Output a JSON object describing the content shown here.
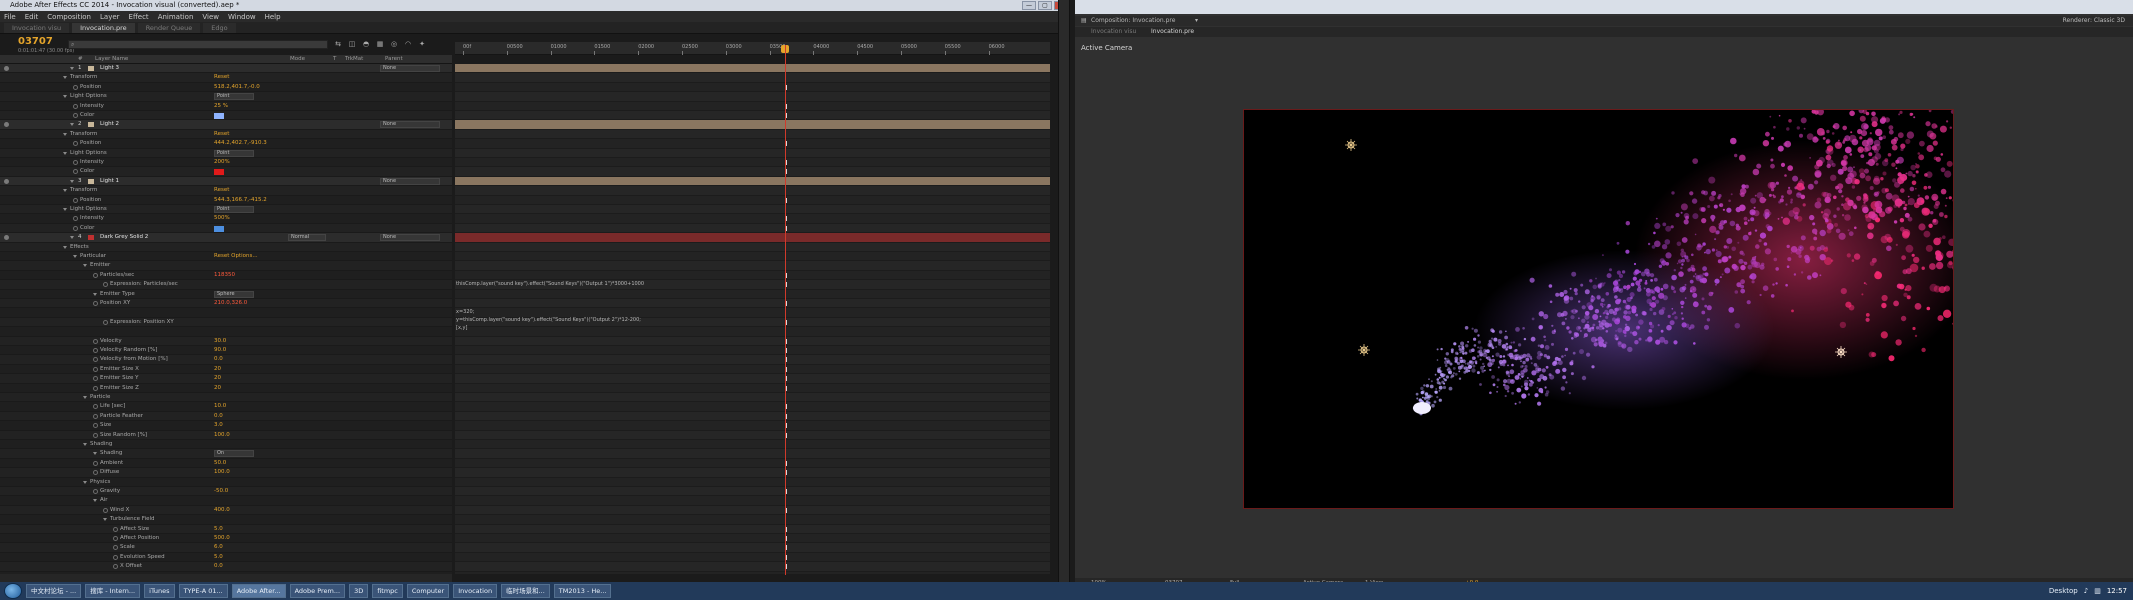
{
  "window": {
    "title": "Adobe After Effects CC 2014 - Invocation visual (converted).aep *",
    "controls": [
      "—",
      "▢",
      "✕"
    ]
  },
  "menu": [
    "File",
    "Edit",
    "Composition",
    "Layer",
    "Effect",
    "Animation",
    "View",
    "Window",
    "Help"
  ],
  "tabs": [
    {
      "label": "Invocation visu",
      "active": false
    },
    {
      "label": "Invocation.pre",
      "active": true
    },
    {
      "label": "Render Queue",
      "active": false
    },
    {
      "label": "Edgo",
      "active": false
    }
  ],
  "timeline": {
    "timecode": "03707",
    "timecode_sub": "0:01:01:47 (30.00 fps)",
    "search": "",
    "ruler_ticks": [
      "00f",
      "00500",
      "01000",
      "01500",
      "02000",
      "02500",
      "03000",
      "03500",
      "04000",
      "04500",
      "05000",
      "05500",
      "06000"
    ],
    "columns": {
      "name": "Layer Name",
      "mode": "Mode",
      "t": "T",
      "trkmat": "TrkMat",
      "parent": "Parent"
    },
    "rows": [
      {
        "kind": "layer",
        "num": "1",
        "name": "Light 3",
        "lc": "#c8b79a",
        "parent": "None"
      },
      {
        "kind": "group",
        "indent": 1,
        "name": "Transform",
        "val": "Reset"
      },
      {
        "kind": "prop",
        "indent": 2,
        "name": "Position",
        "val": "518.2,401.7,-0.0"
      },
      {
        "kind": "group",
        "indent": 1,
        "name": "Light Options",
        "dd": "Point"
      },
      {
        "kind": "prop",
        "indent": 2,
        "name": "Intensity",
        "val": "25 %"
      },
      {
        "kind": "color",
        "indent": 2,
        "name": "Color",
        "color": "#8fb4ff"
      },
      {
        "kind": "layer",
        "num": "2",
        "name": "Light 2",
        "lc": "#c8b79a",
        "parent": "None"
      },
      {
        "kind": "group",
        "indent": 1,
        "name": "Transform",
        "val": "Reset"
      },
      {
        "kind": "prop",
        "indent": 2,
        "name": "Position",
        "val": "444.2,402.7,-910.3"
      },
      {
        "kind": "group",
        "indent": 1,
        "name": "Light Options",
        "dd": "Point"
      },
      {
        "kind": "prop",
        "indent": 2,
        "name": "Intensity",
        "val": "200%"
      },
      {
        "kind": "color",
        "indent": 2,
        "name": "Color",
        "color": "#e01a1a"
      },
      {
        "kind": "layer",
        "num": "3",
        "name": "Light 1",
        "lc": "#c8b79a",
        "parent": "None"
      },
      {
        "kind": "group",
        "indent": 1,
        "name": "Transform",
        "val": "Reset"
      },
      {
        "kind": "prop",
        "indent": 2,
        "name": "Position",
        "val": "544.3,166.7,-415.2"
      },
      {
        "kind": "group",
        "indent": 1,
        "name": "Light Options",
        "dd": "Point"
      },
      {
        "kind": "prop",
        "indent": 2,
        "name": "Intensity",
        "val": "500%"
      },
      {
        "kind": "color",
        "indent": 2,
        "name": "Color",
        "color": "#4d8fe0"
      },
      {
        "kind": "layer",
        "num": "4",
        "name": "Dark Grey Solid 2",
        "lc": "#c03030",
        "parent": "None",
        "mode": "Normal",
        "red": true
      },
      {
        "kind": "group",
        "indent": 1,
        "name": "Effects"
      },
      {
        "kind": "group",
        "indent": 2,
        "name": "Particular",
        "val": "Reset    Options..."
      },
      {
        "kind": "group",
        "indent": 3,
        "name": "Emitter"
      },
      {
        "kind": "prop",
        "indent": 4,
        "name": "Particles/sec",
        "val": "118350",
        "red": true
      },
      {
        "kind": "prop",
        "indent": 5,
        "name": "Expression: Particles/sec",
        "val": ""
      },
      {
        "kind": "group",
        "indent": 4,
        "name": "Emitter Type",
        "dd": "Sphere"
      },
      {
        "kind": "prop",
        "indent": 4,
        "name": "Position XY",
        "val": "210.0,326.0",
        "red": true
      },
      {
        "kind": "spacer"
      },
      {
        "kind": "prop",
        "indent": 5,
        "name": "Expression: Position XY",
        "val": ""
      },
      {
        "kind": "spacer"
      },
      {
        "kind": "prop",
        "indent": 4,
        "name": "Velocity",
        "val": "30.0"
      },
      {
        "kind": "prop",
        "indent": 4,
        "name": "Velocity Random [%]",
        "val": "90.0"
      },
      {
        "kind": "prop",
        "indent": 4,
        "name": "Velocity from Motion [%]",
        "val": "0.0"
      },
      {
        "kind": "prop",
        "indent": 4,
        "name": "Emitter Size X",
        "val": "20"
      },
      {
        "kind": "prop",
        "indent": 4,
        "name": "Emitter Size Y",
        "val": "20"
      },
      {
        "kind": "prop",
        "indent": 4,
        "name": "Emitter Size Z",
        "val": "20"
      },
      {
        "kind": "group",
        "indent": 3,
        "name": "Particle"
      },
      {
        "kind": "prop",
        "indent": 4,
        "name": "Life [sec]",
        "val": "10.0"
      },
      {
        "kind": "prop",
        "indent": 4,
        "name": "Particle Feather",
        "val": "0.0"
      },
      {
        "kind": "prop",
        "indent": 4,
        "name": "Size",
        "val": "3.0"
      },
      {
        "kind": "prop",
        "indent": 4,
        "name": "Size Random [%]",
        "val": "100.0"
      },
      {
        "kind": "group",
        "indent": 3,
        "name": "Shading"
      },
      {
        "kind": "group",
        "indent": 4,
        "name": "Shading",
        "dd": "On"
      },
      {
        "kind": "prop",
        "indent": 4,
        "name": "Ambient",
        "val": "50.0"
      },
      {
        "kind": "prop",
        "indent": 4,
        "name": "Diffuse",
        "val": "100.0"
      },
      {
        "kind": "group",
        "indent": 3,
        "name": "Physics"
      },
      {
        "kind": "prop",
        "indent": 4,
        "name": "Gravity",
        "val": "-50.0"
      },
      {
        "kind": "group",
        "indent": 4,
        "name": "Air"
      },
      {
        "kind": "prop",
        "indent": 5,
        "name": "Wind X",
        "val": "400.0"
      },
      {
        "kind": "group",
        "indent": 5,
        "name": "Turbulence Field"
      },
      {
        "kind": "prop",
        "indent": 6,
        "name": "Affect Size",
        "val": "5.0"
      },
      {
        "kind": "prop",
        "indent": 6,
        "name": "Affect Position",
        "val": "500.0"
      },
      {
        "kind": "prop",
        "indent": 6,
        "name": "Scale",
        "val": "6.0"
      },
      {
        "kind": "prop",
        "indent": 6,
        "name": "Evolution Speed",
        "val": "5.0"
      },
      {
        "kind": "prop",
        "indent": 6,
        "name": "X Offset",
        "val": "0.0"
      }
    ],
    "expressions": [
      {
        "row": 23,
        "lines": [
          "thisComp.layer(\"sound key\").effect(\"Sound Keys\")(\"Output 1\")*3000+1000"
        ]
      },
      {
        "row": 26,
        "lines": [
          "x=320;",
          "y=thisComp.layer(\"sound key\").effect(\"Sound Keys\")(\"Output 2\")*12-200;",
          "[x,y]"
        ]
      }
    ]
  },
  "comp": {
    "tab_composition": "Composition: Invocation.pre",
    "tab_invocation": "Invocation visu",
    "tab_pre": "Invocation.pre",
    "renderer_label": "Renderer:",
    "renderer_value": "Classic 3D",
    "active_camera": "Active Camera",
    "bottom_zoom": "100%",
    "bottom_time": "03707",
    "bottom_res": "Full",
    "bottom_view": "Active Camera",
    "bottom_views": "1 View",
    "bottom_exposure": "+0.0"
  },
  "taskbar": {
    "items": [
      {
        "label": "中文村论坛 - ...",
        "active": false
      },
      {
        "label": "搜库 - Intern...",
        "active": false
      },
      {
        "label": "iTunes",
        "active": false
      },
      {
        "label": "TYPE-A 01...",
        "active": false
      },
      {
        "label": "Adobe After...",
        "active": true
      },
      {
        "label": "Adobe Prem...",
        "active": false
      },
      {
        "label": "3D",
        "active": false
      },
      {
        "label": "fitmpc",
        "active": false
      },
      {
        "label": "Computer",
        "active": false
      },
      {
        "label": "Invocation",
        "active": false
      },
      {
        "label": "临时场景和...",
        "active": false
      },
      {
        "label": "TM2013 - He...",
        "active": false
      }
    ],
    "desktop": "Desktop",
    "clock": "12:57"
  },
  "colors": {
    "accent": "#e5a52b",
    "playhead": "#d03a2b",
    "light_bar": "#8a7660",
    "solid_bar": "#7a2a2a"
  }
}
